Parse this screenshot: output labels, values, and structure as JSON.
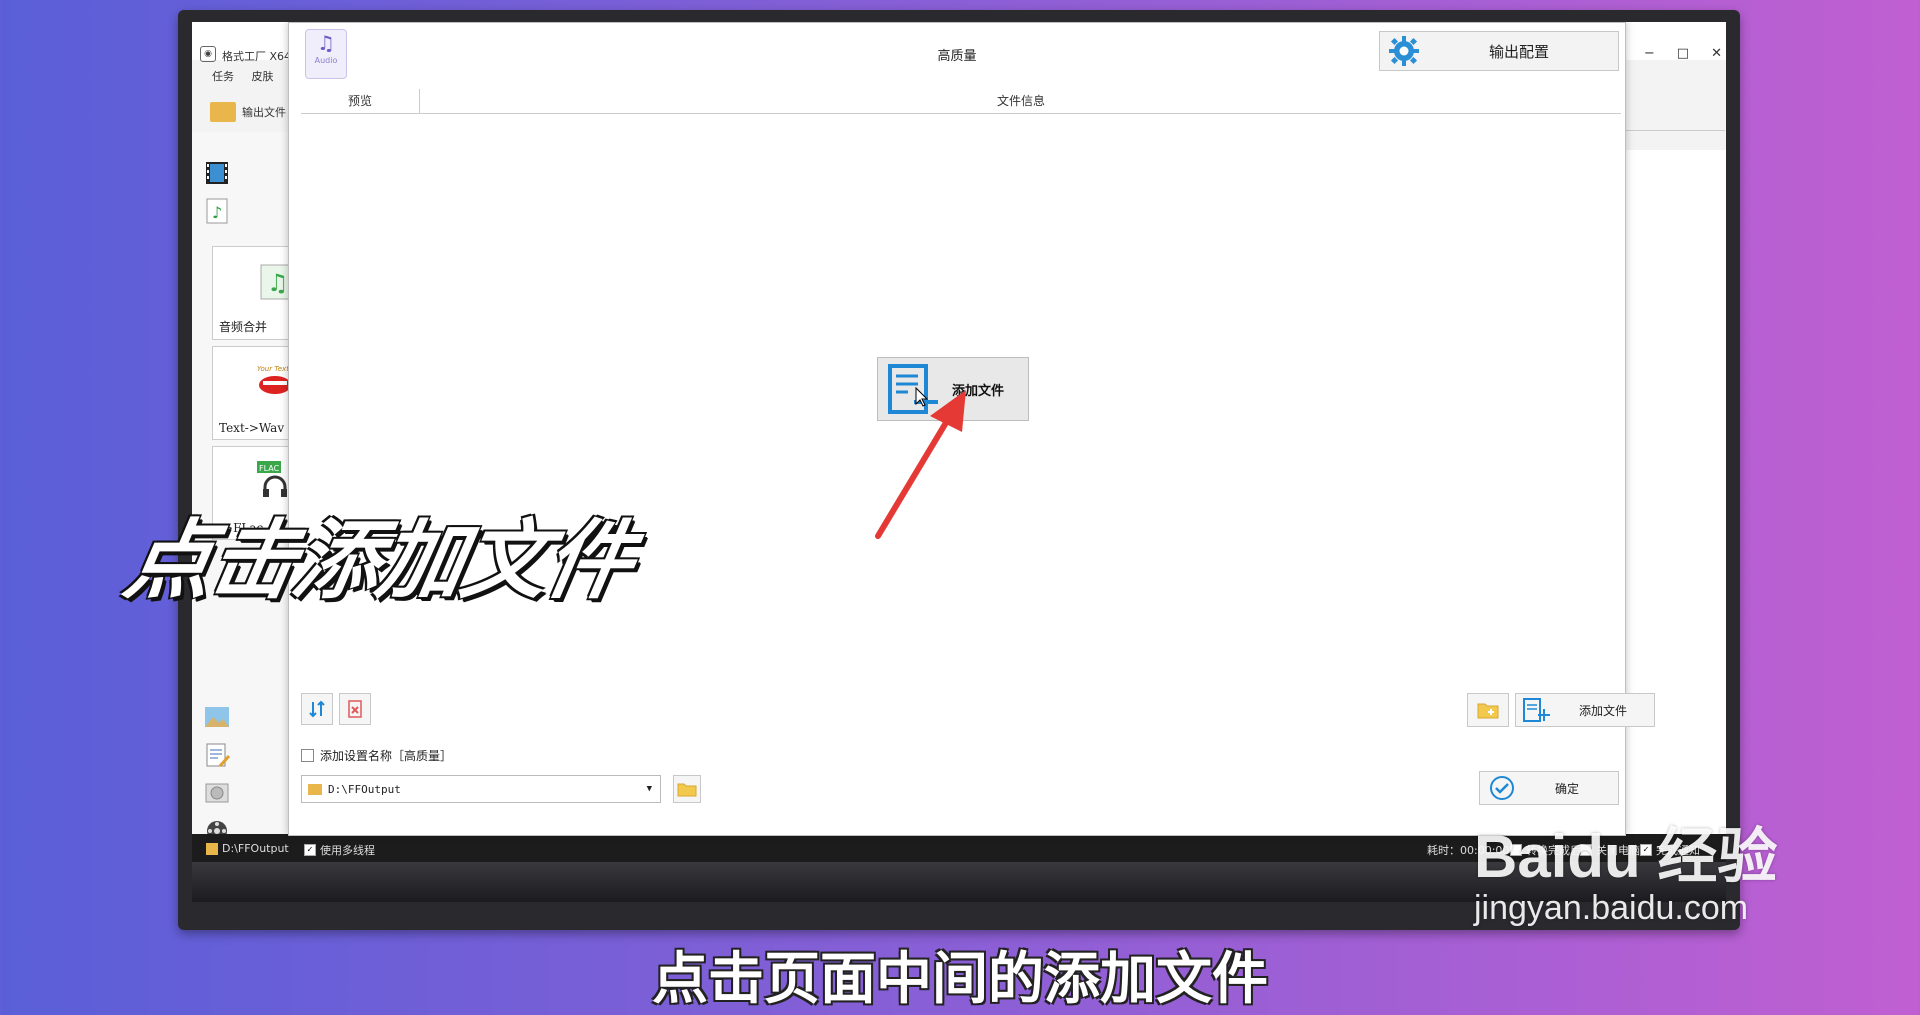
{
  "app": {
    "title": "格式工厂 X64",
    "menu": [
      "任务",
      "皮肤"
    ],
    "output_folder_label": "输出文件",
    "window_controls": [
      "−",
      "□",
      "✕"
    ]
  },
  "sidebar": {
    "tiles": [
      {
        "label": "音频合并"
      },
      {
        "label": "Text->Wav"
      },
      {
        "label": "->FLac",
        "badge": "FLAC"
      }
    ]
  },
  "statusbar": {
    "path": "D:\\FFOutput",
    "multithread": "使用多线程",
    "elapsed_label": "耗时：00:00:00",
    "after_convert": "转换完成后",
    "shutdown": "关闭电脑",
    "done_notify": "完成通知"
  },
  "dialog": {
    "icon_caption": "Audio",
    "title": "高质量",
    "output_config": "输出配置",
    "columns": {
      "preview": "预览",
      "file_info": "文件信息"
    },
    "center_add": "添加文件",
    "add_files_button": "添加文件",
    "ok_button": "确定",
    "checkbox_label": "添加设置名称［高质量］",
    "output_path": "D:\\FFOutput"
  },
  "overlay": {
    "title": "点击添加文件",
    "caption": "点击页面中间的添加文件"
  },
  "watermark": {
    "brand": "Baidu 经验",
    "url": "jingyan.baidu.com"
  },
  "colors": {
    "accent_blue": "#1e88d6",
    "arrow_red": "#e53935",
    "folder_yellow": "#e8b64a"
  }
}
